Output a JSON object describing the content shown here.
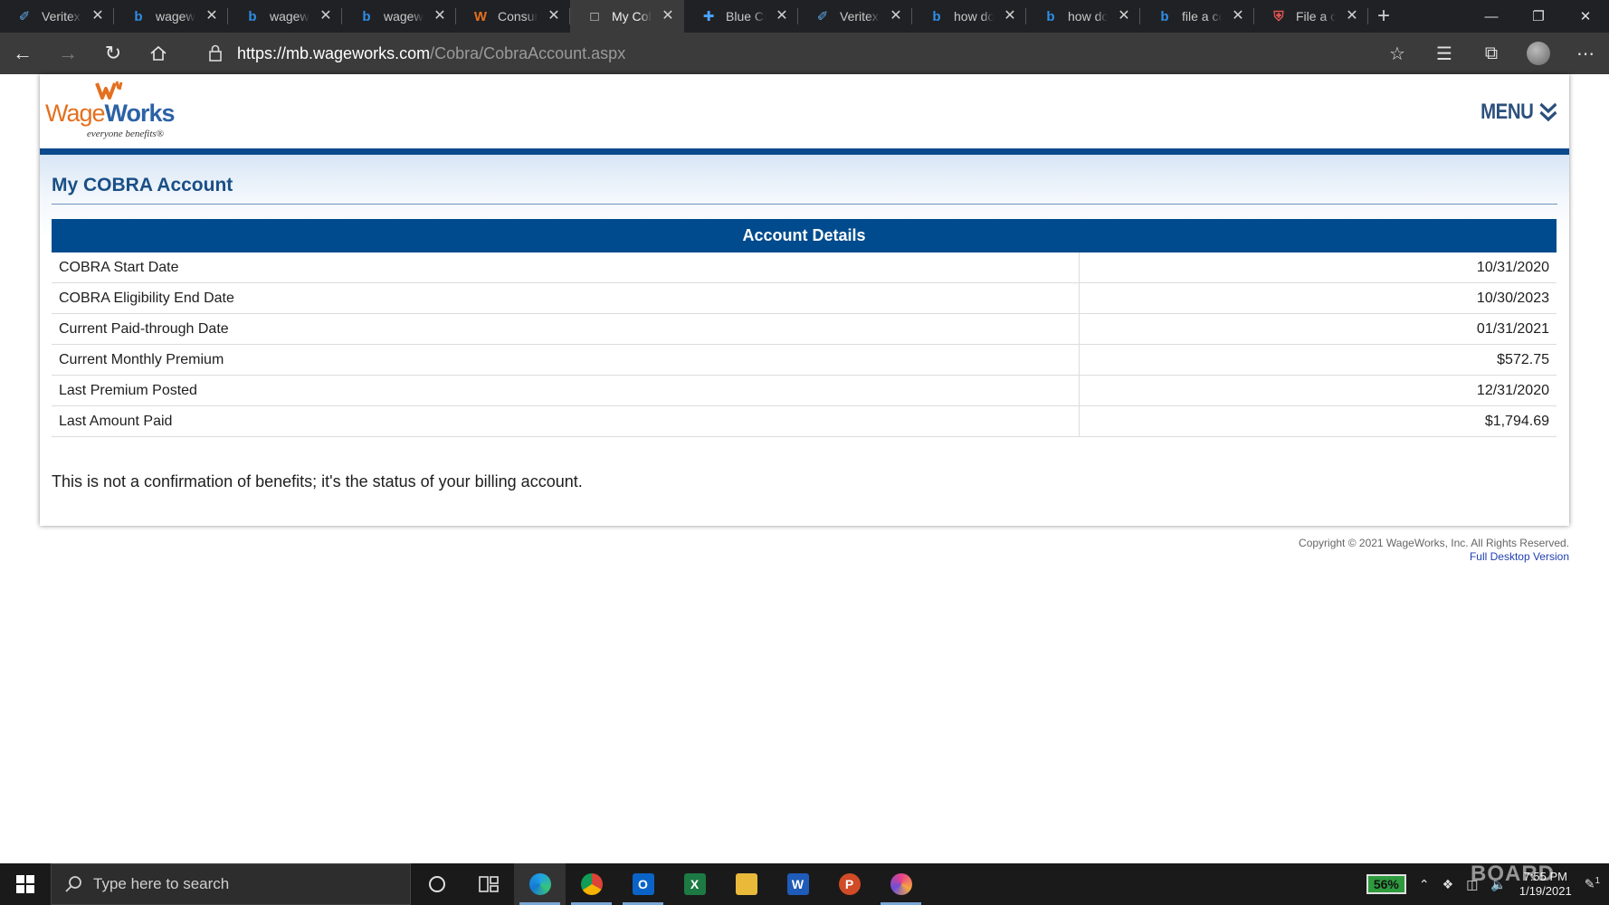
{
  "browser": {
    "tabs": [
      {
        "label": "Veritext",
        "icon": "veritext-icon"
      },
      {
        "label": "wageworks",
        "icon": "bing-icon"
      },
      {
        "label": "wageworks",
        "icon": "bing-icon"
      },
      {
        "label": "wageworks",
        "icon": "bing-icon"
      },
      {
        "label": "Consumer",
        "icon": "wageworks-icon"
      },
      {
        "label": "My Cobra",
        "icon": "page-icon",
        "active": true
      },
      {
        "label": "Blue Cross",
        "icon": "bluecross-icon"
      },
      {
        "label": "Veritext",
        "icon": "veritext-icon"
      },
      {
        "label": "how do",
        "icon": "bing-icon"
      },
      {
        "label": "how do",
        "icon": "bing-icon"
      },
      {
        "label": "file a co",
        "icon": "bing-icon"
      },
      {
        "label": "File a co",
        "icon": "shield-icon"
      }
    ],
    "url_host": "https://mb.wageworks.com",
    "url_path": "/Cobra/CobraAccount.aspx"
  },
  "site": {
    "logo_wage": "Wage",
    "logo_works": "Works",
    "logo_tagline": "everyone benefits®",
    "menu_label": "MENU",
    "page_title": "My COBRA Account",
    "details_title": "Account Details",
    "details_rows": [
      {
        "label": "COBRA Start Date",
        "value": "10/31/2020"
      },
      {
        "label": "COBRA Eligibility End Date",
        "value": "10/30/2023"
      },
      {
        "label": "Current Paid-through Date",
        "value": "01/31/2021"
      },
      {
        "label": "Current Monthly Premium",
        "value": "$572.75"
      },
      {
        "label": "Last Premium Posted",
        "value": "12/31/2020"
      },
      {
        "label": "Last Amount Paid",
        "value": "$1,794.69"
      }
    ],
    "disclaimer": "This is not a confirmation of benefits; it's the status of your billing account.",
    "copyright": "Copyright © 2021 WageWorks, Inc. All Rights Reserved.",
    "full_desktop_link": "Full Desktop Version"
  },
  "taskbar": {
    "search_placeholder": "Type here to search",
    "battery": "56%",
    "time": "7:55 PM",
    "date": "1/19/2021",
    "watermark": "BOARD",
    "notification_count": "1"
  },
  "colors": {
    "brand_blue": "#004b8d",
    "brand_orange": "#e46f1e"
  }
}
